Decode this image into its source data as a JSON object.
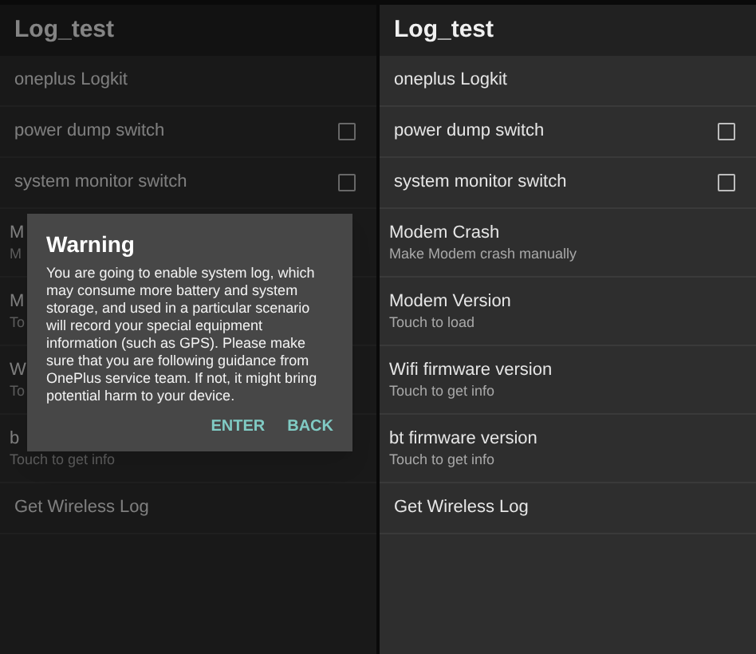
{
  "screens": [
    {
      "dimmed": true,
      "title": "Log_test",
      "items": [
        {
          "kind": "plain",
          "title": "oneplus Logkit"
        },
        {
          "kind": "checkbox",
          "title": "power dump switch",
          "checked": false
        },
        {
          "kind": "checkbox",
          "title": "system monitor switch",
          "checked": false
        },
        {
          "kind": "two_line",
          "title": "M",
          "subtitle": "M"
        },
        {
          "kind": "two_line",
          "title": "M",
          "subtitle": "To"
        },
        {
          "kind": "two_line",
          "title": "W",
          "subtitle": "To"
        },
        {
          "kind": "two_line",
          "title": "b",
          "subtitle": "Touch to get info"
        },
        {
          "kind": "plain",
          "title": "Get Wireless Log"
        }
      ],
      "dialog": {
        "title": "Warning",
        "message": "You are going to enable system log, which may consume more battery and system storage, and used in a particular scenario will record your special equipment information (such as GPS). Please make sure that you are following guidance from OnePlus service team. If not, it might bring potential harm to your device.",
        "buttons": [
          "ENTER",
          "BACK"
        ]
      }
    },
    {
      "dimmed": false,
      "title": "Log_test",
      "items": [
        {
          "kind": "plain",
          "title": "oneplus Logkit"
        },
        {
          "kind": "checkbox",
          "title": "power dump switch",
          "checked": false
        },
        {
          "kind": "checkbox",
          "title": "system monitor switch",
          "checked": false
        },
        {
          "kind": "two_line",
          "title": "Modem Crash",
          "subtitle": "Make Modem crash manually"
        },
        {
          "kind": "two_line",
          "title": "Modem Version",
          "subtitle": "Touch to load"
        },
        {
          "kind": "two_line",
          "title": "Wifi firmware version",
          "subtitle": "Touch to get info"
        },
        {
          "kind": "two_line",
          "title": "bt firmware version",
          "subtitle": "Touch to get info"
        },
        {
          "kind": "plain",
          "title": "Get Wireless Log"
        }
      ]
    }
  ]
}
